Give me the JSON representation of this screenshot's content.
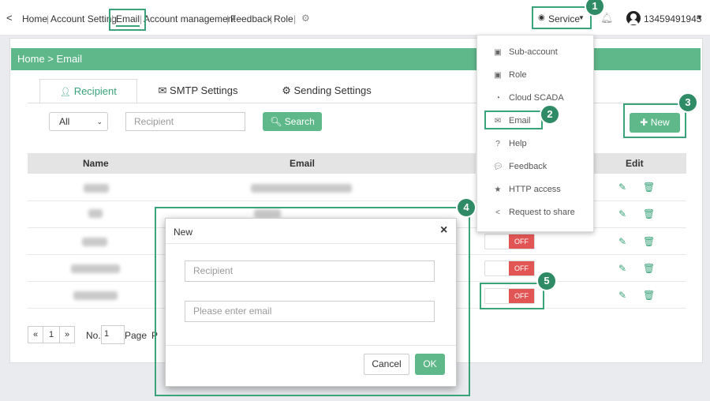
{
  "topnav": {
    "back": "<",
    "items": [
      "Home",
      "Account Setting",
      "Email",
      "Account management",
      "Feedback",
      "Role"
    ],
    "separator": "|",
    "service_label": "Service",
    "username": "13459491945"
  },
  "breadcrumb": "Home > Email",
  "tabs": [
    "Recipient",
    "SMTP Settings",
    "Sending Settings"
  ],
  "filter": {
    "select_value": "All",
    "recipient_placeholder": "Recipient",
    "search_label": "Search",
    "new_label": "New"
  },
  "table": {
    "headers": [
      "Name",
      "Email",
      "Edit"
    ]
  },
  "toggle_label": "OFF",
  "dropdown": {
    "items": [
      {
        "label": "Sub-account",
        "icon": "user-card-icon"
      },
      {
        "label": "Role",
        "icon": "user-card-icon"
      },
      {
        "label": "Cloud SCADA",
        "icon": "gauge-icon"
      },
      {
        "label": "Email",
        "icon": "envelope-icon"
      },
      {
        "label": "Help",
        "icon": "question-icon"
      },
      {
        "label": "Feedback",
        "icon": "comment-icon"
      },
      {
        "label": "HTTP access",
        "icon": "star-icon"
      },
      {
        "label": "Request to share",
        "icon": "share-icon"
      }
    ]
  },
  "modal": {
    "title": "New",
    "close": "×",
    "recipient_placeholder": "Recipient",
    "email_placeholder": "Please enter email",
    "cancel_label": "Cancel",
    "ok_label": "OK"
  },
  "pager": {
    "prev": "«",
    "page": "1",
    "next": "»",
    "no_label": "No.",
    "page_input": "1",
    "page_label": "Page",
    "trailing": "P"
  },
  "badges": [
    "1",
    "2",
    "3",
    "4",
    "5"
  ],
  "colors": {
    "accent": "#5fb88a",
    "callout": "#3aa37a",
    "off": "#e25555"
  }
}
